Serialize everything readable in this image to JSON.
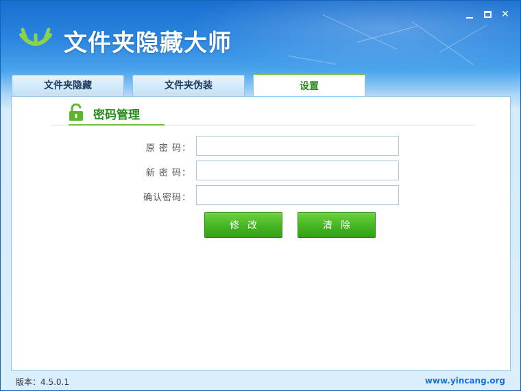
{
  "app": {
    "title": "文件夹隐藏大师"
  },
  "window_controls": {
    "minimize": "minimize",
    "maximize": "maximize",
    "close": "✕"
  },
  "tabs": [
    {
      "label": "文件夹隐藏",
      "active": false
    },
    {
      "label": "文件夹伪装",
      "active": false
    },
    {
      "label": "设置",
      "active": true
    }
  ],
  "section": {
    "title": "密码管理",
    "icon": "lock-open-icon"
  },
  "form": {
    "old_password_label": "原 密 码：",
    "new_password_label": "新 密 码：",
    "confirm_password_label": "确认密码：",
    "old_password_value": "",
    "new_password_value": "",
    "confirm_password_value": ""
  },
  "buttons": {
    "modify": "修改",
    "clear": "清除"
  },
  "footer": {
    "version": "版本：4.5.0.1",
    "url": "www.yincang.org"
  },
  "colors": {
    "accent_green": "#45b423",
    "title_blue": "#1a6fcf",
    "link_blue": "#1a73d6"
  }
}
